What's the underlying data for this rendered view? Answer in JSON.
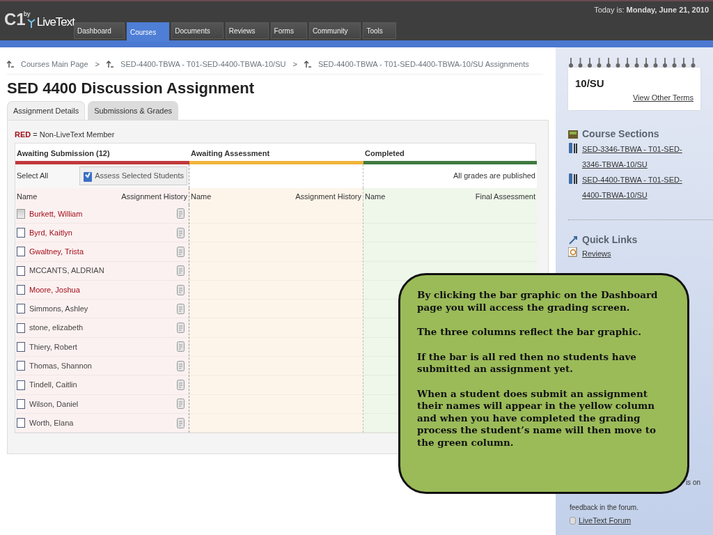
{
  "header": {
    "logo_mark": "C1",
    "logo_by": "by",
    "logo_name": "LiveText",
    "date_label": "Today is:",
    "date": "Monday, June 21, 2010",
    "nav": [
      {
        "label": "Dashboard",
        "selected": false
      },
      {
        "label": "Courses",
        "selected": true
      },
      {
        "label": "Documents",
        "selected": false
      },
      {
        "label": "Reviews",
        "selected": false
      },
      {
        "label": "Forms",
        "selected": false
      },
      {
        "label": "Community",
        "selected": false
      },
      {
        "label": "Tools",
        "selected": false
      }
    ]
  },
  "breadcrumbs": [
    "Courses Main Page",
    "SED-4400-TBWA - T01-SED-4400-TBWA-10/SU",
    "SED-4400-TBWA - T01-SED-4400-TBWA-10/SU Assignments"
  ],
  "breadcrumb_separator": ">",
  "title": "SED 4400 Discussion Assignment",
  "tabs": [
    {
      "label": "Assignment Details",
      "selected": false
    },
    {
      "label": "Submissions & Grades",
      "selected": true
    }
  ],
  "legend": {
    "key": "RED",
    "text": " = Non-LiveText Member"
  },
  "columns": [
    {
      "title": "Awaiting Submission (12)",
      "color": "#c0393b",
      "name_header": "Name",
      "extra_header": "Assignment History"
    },
    {
      "title": "Awaiting Assessment",
      "color": "#f0b43c",
      "name_header": "Name",
      "extra_header": "Assignment History"
    },
    {
      "title": "Completed",
      "color": "#3f7a3f",
      "name_header": "Name",
      "extra_header": "Final Assessment"
    }
  ],
  "select_all": "Select All",
  "assess_button": "Assess Selected Students",
  "published_note": "All grades are published",
  "students": [
    {
      "name": "Burkett, William",
      "member": false,
      "disabled": true
    },
    {
      "name": "Byrd, Kaitlyn",
      "member": false,
      "disabled": false
    },
    {
      "name": "Gwaltney, Trista",
      "member": false,
      "disabled": false
    },
    {
      "name": "MCCANTS, ALDRIAN",
      "member": true,
      "disabled": false
    },
    {
      "name": "Moore, Joshua",
      "member": false,
      "disabled": false
    },
    {
      "name": "Simmons, Ashley",
      "member": true,
      "disabled": false
    },
    {
      "name": "stone, elizabeth",
      "member": true,
      "disabled": false
    },
    {
      "name": "Thiery, Robert",
      "member": true,
      "disabled": false
    },
    {
      "name": "Thomas, Shannon",
      "member": true,
      "disabled": false
    },
    {
      "name": "Tindell, Caitlin",
      "member": true,
      "disabled": false
    },
    {
      "name": "Wilson, Daniel",
      "member": true,
      "disabled": false
    },
    {
      "name": "Worth, Elana",
      "member": true,
      "disabled": false
    }
  ],
  "sidebar": {
    "term": "10/SU",
    "other_terms": "View Other Terms",
    "sections_title": "Course Sections",
    "sections": [
      "SED-3346-TBWA - T01-SED-3346-TBWA-10/SU",
      "SED-4400-TBWA - T01-SED-4400-TBWA-10/SU"
    ],
    "quick_links_title": "Quick Links",
    "quick_links": [
      "Reviews"
    ],
    "feedback_fragment": "is on",
    "feedback_end": "feedback in the forum.",
    "forum_link": "LiveText Forum"
  },
  "callout": {
    "paragraphs": [
      "By clicking the bar graphic on the Dashboard page you will access the grading screen.",
      "The three columns reflect the bar graphic.",
      "If the bar is all red then no students have submitted an assignment yet.",
      "When a student does submit an assignment their names will appear in the yellow column and when you have completed the grading process the student’s name will then move to the green column."
    ]
  }
}
